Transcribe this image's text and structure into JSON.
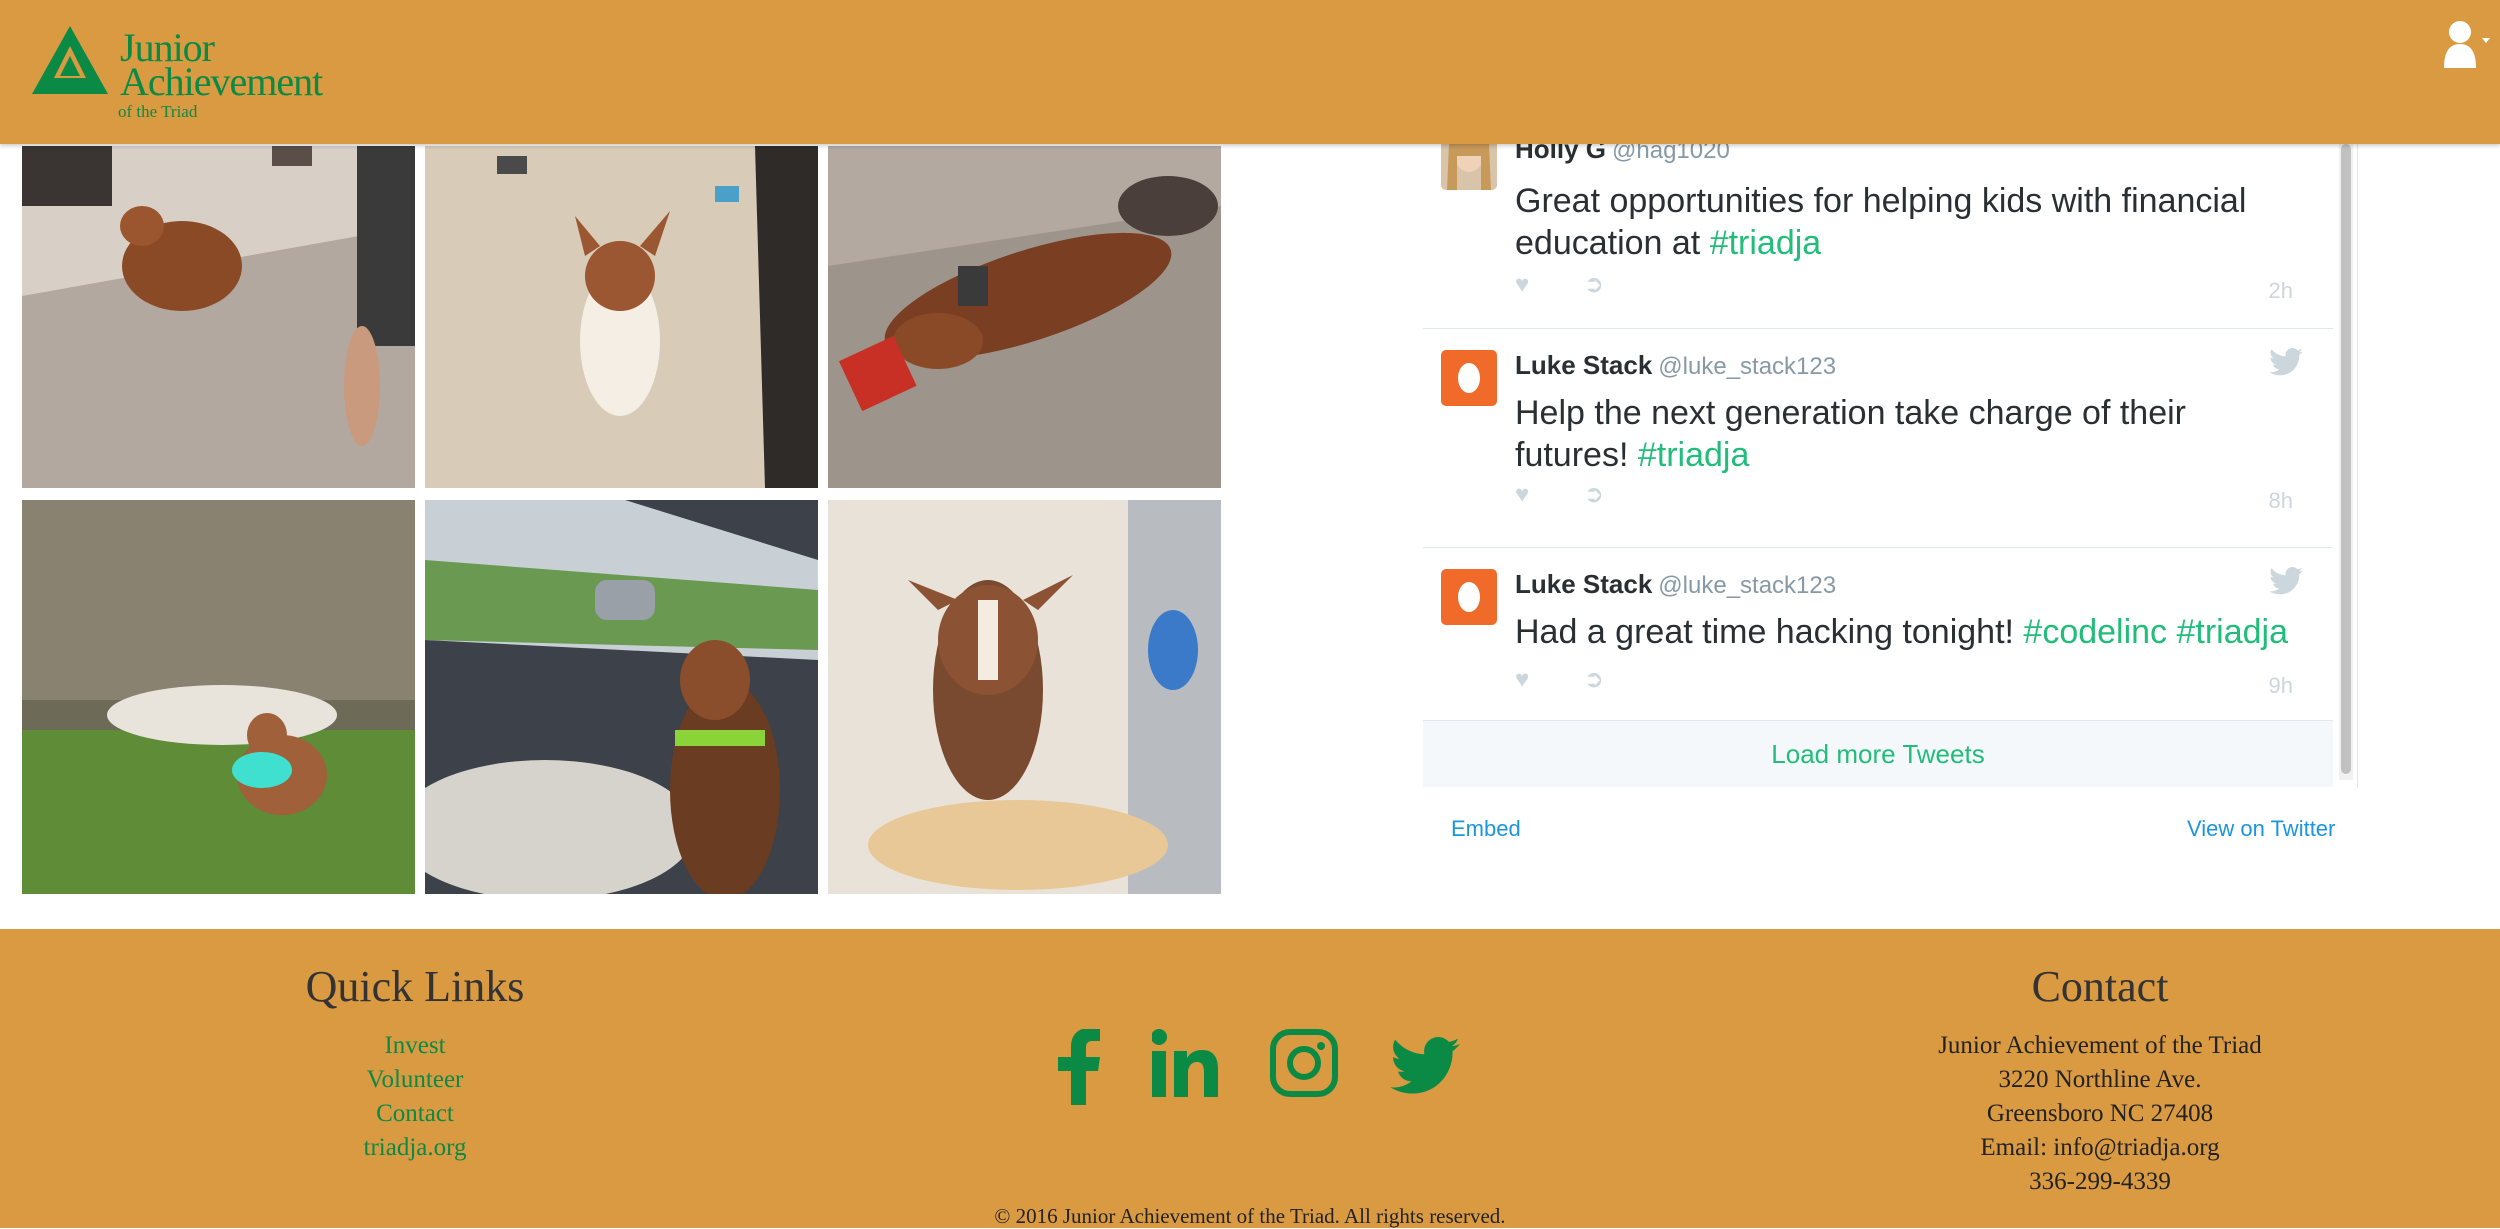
{
  "header": {
    "logo_line1": "Junior",
    "logo_line2": "Achievement",
    "logo_line3": "of the Triad",
    "user_icon": "user-icon"
  },
  "photos": [
    {
      "name": "dog-running-indoors"
    },
    {
      "name": "dog-sitting-carpet"
    },
    {
      "name": "dog-lying-with-toy"
    },
    {
      "name": "dog-with-frisbee-outdoors"
    },
    {
      "name": "dog-in-car"
    },
    {
      "name": "dog-in-bathtub"
    }
  ],
  "twitter": {
    "tweets": [
      {
        "author": "Holly G",
        "handle": "@hag1020",
        "text": "Great opportunities for helping kids with financial education at ",
        "hashtags": "#triadja",
        "time": "2h"
      },
      {
        "author": "Luke Stack",
        "handle": "@luke_stack123",
        "text": "Help the next generation take charge of their futures! ",
        "hashtags": "#triadja",
        "time": "8h"
      },
      {
        "author": "Luke Stack",
        "handle": "@luke_stack123",
        "text": "Had a great time hacking tonight! ",
        "hashtags": "#codelinc #triadja",
        "time": "9h"
      }
    ],
    "load_more": "Load more Tweets",
    "embed": "Embed",
    "view_on_twitter": "View on Twitter"
  },
  "footer": {
    "quick_links_title": "Quick Links",
    "quick_links": [
      "Invest",
      "Volunteer",
      "Contact",
      "triadja.org"
    ],
    "social": [
      "facebook-icon",
      "linkedin-icon",
      "instagram-icon",
      "twitter-icon"
    ],
    "contact_title": "Contact",
    "contact_lines": [
      "Junior Achievement of the Triad",
      "3220 Northline Ave.",
      "Greensboro NC 27408",
      "Email: info@triadja.org",
      "336-299-4339"
    ],
    "copyright": "© 2016 Junior Achievement of the Triad. All rights reserved."
  },
  "colors": {
    "brand_orange": "#d99a42",
    "brand_green": "#0b8a45",
    "twitter_hashtag": "#22bd7a",
    "twitter_link": "#1b95e0"
  }
}
